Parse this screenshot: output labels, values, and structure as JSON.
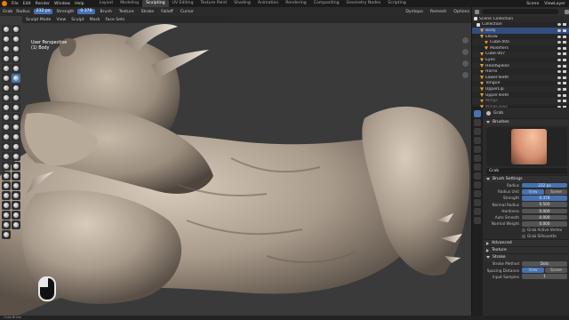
{
  "menubar": {
    "menus": [
      "File",
      "Edit",
      "Render",
      "Window",
      "Help"
    ],
    "workspaces": [
      "Layout",
      "Modeling",
      "Sculpting",
      "UV Editing",
      "Texture Paint",
      "Shading",
      "Animation",
      "Rendering",
      "Compositing",
      "Geometry Nodes",
      "Scripting"
    ],
    "active_workspace": "Sculpting",
    "scene": "Scene",
    "view_layer": "ViewLayer"
  },
  "tool_header": {
    "tool": "Grab",
    "radius_label": "Radius",
    "radius_value": "232 px",
    "strength_label": "Strength",
    "strength_value": "0.378",
    "items": [
      "Brush",
      "Texture",
      "Stroke",
      "Falloff",
      "Cursor"
    ],
    "right_items": [
      "Dyntopo",
      "Remesh",
      "Options"
    ]
  },
  "viewport_header": {
    "items": [
      "Sculpt Mode",
      "View",
      "Sculpt",
      "Mask",
      "Face Sets"
    ]
  },
  "viewport": {
    "overlay_line1": "User Perspective",
    "overlay_line2": "(1) Body"
  },
  "outliner": {
    "rows": [
      {
        "name": "Scene Collection",
        "type": "col",
        "dim": false
      },
      {
        "name": "Collection",
        "type": "col",
        "dim": false
      },
      {
        "name": "Body",
        "type": "obj",
        "dim": false,
        "selected": true
      },
      {
        "name": "Elbow",
        "type": "obj",
        "dim": false
      },
      {
        "name": "Cube.005",
        "type": "obj",
        "dim": false
      },
      {
        "name": "Modifiers",
        "type": "obj",
        "dim": false
      },
      {
        "name": "Cube.007",
        "type": "obj",
        "dim": false
      },
      {
        "name": "Eyes",
        "type": "obj",
        "dim": false
      },
      {
        "name": "HeadSpikes",
        "type": "obj",
        "dim": false
      },
      {
        "name": "Horns",
        "type": "obj",
        "dim": false
      },
      {
        "name": "LowerTeeth",
        "type": "obj",
        "dim": false
      },
      {
        "name": "Tongue",
        "type": "obj",
        "dim": false
      },
      {
        "name": "UpperLip",
        "type": "obj",
        "dim": false
      },
      {
        "name": "UpperTeeth",
        "type": "obj",
        "dim": false
      },
      {
        "name": "Wings",
        "type": "obj",
        "dim": true
      },
      {
        "name": "WingClaws",
        "type": "obj",
        "dim": true
      }
    ]
  },
  "properties": {
    "active_tool": "Grab",
    "brushes_label": "Brushes",
    "brush_name": "Grab",
    "brush_settings_label": "Brush Settings",
    "fields": [
      {
        "k": "Radius",
        "v": "232 px",
        "blue": true
      },
      {
        "k": "Radius Unit",
        "seg": [
          "View",
          "Scene"
        ],
        "on": 0
      },
      {
        "k": "Strength",
        "v": "0.378",
        "blue": true
      },
      {
        "k": "Normal Radius",
        "v": "0.500",
        "blue": false
      },
      {
        "k": "Hardness",
        "v": "0.000",
        "blue": false
      },
      {
        "k": "Auto Smooth",
        "v": "0.000",
        "blue": false
      },
      {
        "k": "Normal Weight",
        "v": "0.000",
        "blue": false
      }
    ],
    "checks": [
      "Grab Active Vertex",
      "Grab Silhouette"
    ],
    "collapsed": [
      "Advanced",
      "Texture",
      "Stroke"
    ],
    "stroke_method_label": "Stroke Method",
    "stroke_method_value": "Dots",
    "spacing_label": "Spacing Distance",
    "spacing_seg": [
      "View",
      "Scene"
    ],
    "input_samples_label": "Input Samples",
    "input_samples_value": "1"
  },
  "status": "Grab Brush",
  "colors": {
    "accent": "#4772b3",
    "brand": "#e87d0d",
    "skin": "#a89a8a"
  }
}
